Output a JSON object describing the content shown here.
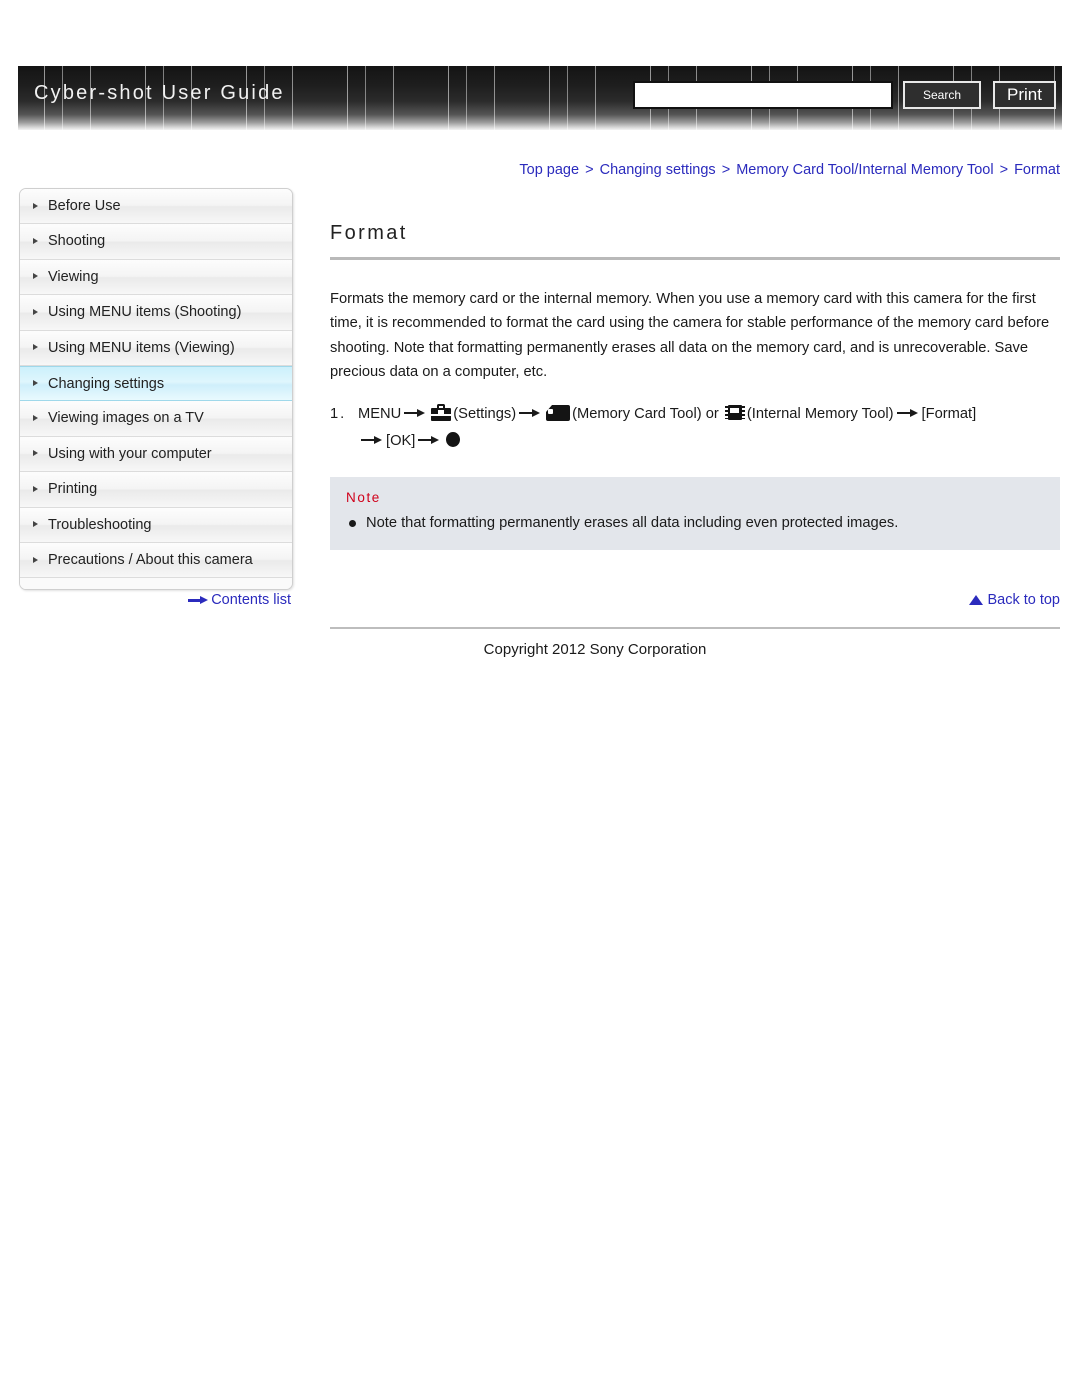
{
  "header": {
    "title": "Cyber-shot User Guide",
    "search": {
      "value": "",
      "placeholder": ""
    },
    "search_button": "Search",
    "print_button": "Print"
  },
  "breadcrumb": {
    "items": [
      "Top page",
      "Changing settings",
      "Memory Card Tool/Internal Memory Tool",
      "Format"
    ],
    "separator": ">"
  },
  "sidebar": {
    "items": [
      {
        "label": "Before Use",
        "active": false
      },
      {
        "label": "Shooting",
        "active": false
      },
      {
        "label": "Viewing",
        "active": false
      },
      {
        "label": "Using MENU items (Shooting)",
        "active": false
      },
      {
        "label": "Using MENU items (Viewing)",
        "active": false
      },
      {
        "label": "Changing settings",
        "active": true
      },
      {
        "label": "Viewing images on a TV",
        "active": false
      },
      {
        "label": "Using with your computer",
        "active": false
      },
      {
        "label": "Printing",
        "active": false
      },
      {
        "label": "Troubleshooting",
        "active": false
      },
      {
        "label": "Precautions / About this camera",
        "active": false
      }
    ],
    "contents_link": "Contents list"
  },
  "main": {
    "title": "Format",
    "paragraph": "Formats the memory card or the internal memory. When you use a memory card with this camera for the first time, it is recommended to format the card using the camera for stable performance of the memory card before shooting. Note that formatting permanently erases all data on the memory card, and is unrecoverable. Save precious data on a computer, etc.",
    "step": {
      "number": "1.",
      "menu": "MENU",
      "settings_label": "(Settings)",
      "memory_card_label": "(Memory Card Tool)",
      "or": "or",
      "internal_memory_label": "(Internal Memory Tool)",
      "format_bracket": "[Format]",
      "ok_bracket": "[OK]"
    },
    "note": {
      "heading": "Note",
      "items": [
        "Note that formatting permanently erases all data including even protected images."
      ]
    },
    "back_to_top": "Back to top"
  },
  "footer": {
    "copyright": "Copyright 2012 Sony Corporation"
  },
  "colors": {
    "link_blue": "#2b2bbd",
    "note_red": "#d0021b",
    "active_item": "#cfeffb",
    "banner_dark": "#141414"
  }
}
